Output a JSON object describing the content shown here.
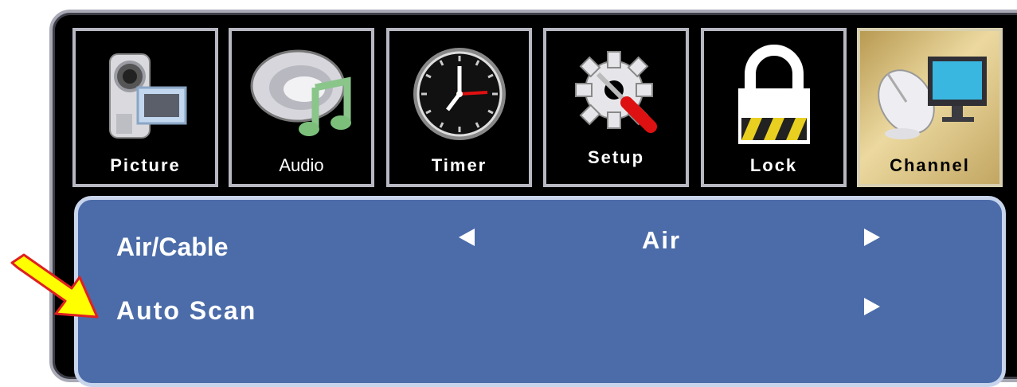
{
  "tabs": [
    {
      "label": "Picture",
      "icon": "camcorder-icon"
    },
    {
      "label": "Audio",
      "icon": "speaker-music-icon"
    },
    {
      "label": "Timer",
      "icon": "clock-icon"
    },
    {
      "label": "Setup",
      "icon": "gear-screwdriver-icon"
    },
    {
      "label": "Lock",
      "icon": "padlock-icon"
    },
    {
      "label": "Channel",
      "icon": "satellite-monitor-icon"
    }
  ],
  "selected_tab": "Channel",
  "rows": [
    {
      "label": "Air/Cable",
      "value": "Air"
    },
    {
      "label": "Auto Scan",
      "value": ""
    }
  ],
  "colors": {
    "panel": "#4b6ca9",
    "active_tab": "#d9c280",
    "pointer": "#ffff00"
  }
}
